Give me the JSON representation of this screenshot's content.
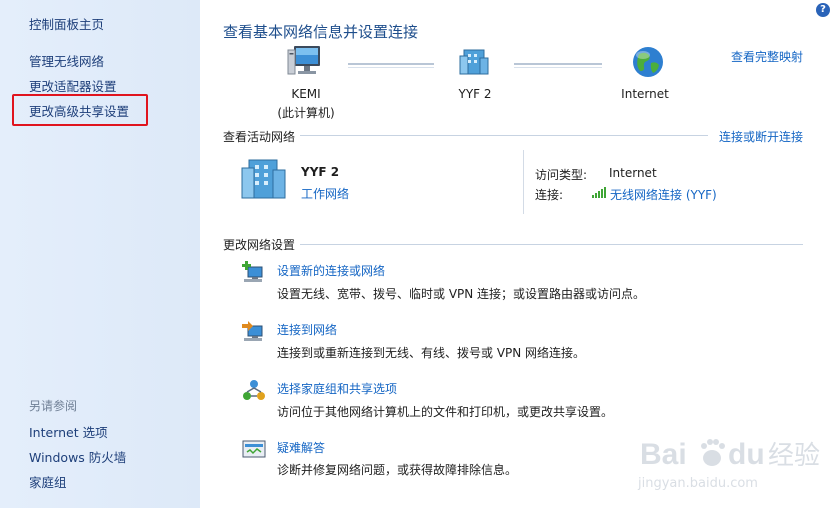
{
  "sidebar": {
    "home": "控制面板主页",
    "items": [
      "管理无线网络",
      "更改适配器设置",
      "更改高级共享设置"
    ],
    "see_also_label": "另请参阅",
    "see_also": [
      "Internet 选项",
      "Windows 防火墙",
      "家庭组"
    ]
  },
  "header": {
    "title": "查看基本网络信息并设置连接",
    "full_map_link": "查看完整映射",
    "help": "?"
  },
  "map": {
    "nodes": [
      {
        "name": "KEMI",
        "sub": "(此计算机)",
        "icon": "computer-icon"
      },
      {
        "name": "YYF  2",
        "sub": "",
        "icon": "network-building-icon"
      },
      {
        "name": "Internet",
        "sub": "",
        "icon": "globe-icon"
      }
    ]
  },
  "active": {
    "title": "查看活动网络",
    "connect_link": "连接或断开连接",
    "network_name": "YYF  2",
    "network_type": "工作网络",
    "access_type_label": "访问类型:",
    "access_type_value": "Internet",
    "connection_label": "连接:",
    "connection_value": "无线网络连接 (YYF)"
  },
  "change": {
    "title": "更改网络设置",
    "tasks": [
      {
        "title": "设置新的连接或网络",
        "desc": "设置无线、宽带、拨号、临时或 VPN 连接；或设置路由器或访问点。",
        "icon": "new-connection-icon"
      },
      {
        "title": "连接到网络",
        "desc": "连接到或重新连接到无线、有线、拨号或 VPN 网络连接。",
        "icon": "connect-network-icon"
      },
      {
        "title": "选择家庭组和共享选项",
        "desc": "访问位于其他网络计算机上的文件和打印机，或更改共享设置。",
        "icon": "homegroup-icon"
      },
      {
        "title": "疑难解答",
        "desc": "诊断并修复网络问题，或获得故障排除信息。",
        "icon": "troubleshoot-icon"
      }
    ]
  },
  "watermark": {
    "brand": "Baidu 经验",
    "url": "jingyan.baidu.com"
  },
  "colors": {
    "link": "#1566c4",
    "title": "#1e4e8c",
    "sidebar_bg": "#dde9f8",
    "highlight": "#e0141e"
  }
}
